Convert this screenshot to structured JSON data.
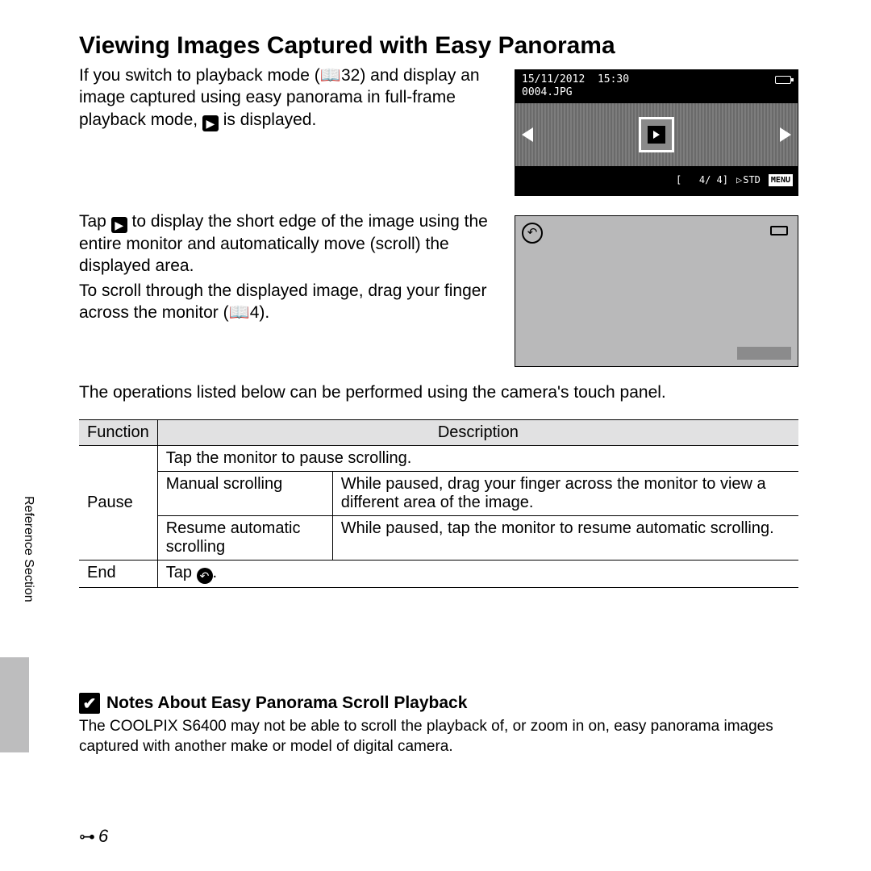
{
  "title": "Viewing Images Captured with Easy Panorama",
  "para1a": "If you switch to playback mode (",
  "para1b": "32) and display an image captured using easy panorama in full-frame playback mode, ",
  "para1c": " is displayed.",
  "para2a": "Tap ",
  "para2b": " to display the short edge of the image using the entire monitor and automatically move (scroll) the displayed area.",
  "para3a": "To scroll through the displayed image, drag your finger across the monitor (",
  "para3b": "4).",
  "para4": "The operations listed below can be performed using the camera's touch panel.",
  "lcd1": {
    "date": "15/11/2012",
    "time": "15:30",
    "file": "0004.JPG",
    "counter": "4/   4",
    "std": "STD",
    "menu": "MENU"
  },
  "table": {
    "h_func": "Function",
    "h_desc": "Description",
    "pause": "Pause",
    "pause_desc": "Tap the monitor to pause scrolling.",
    "manual": "Manual scrolling",
    "manual_desc": "While paused, drag your finger across the monitor to view a different area of the image.",
    "resume": "Resume automatic scrolling",
    "resume_desc": "While paused, tap the monitor to resume automatic scrolling.",
    "end": "End",
    "end_desc_a": "Tap ",
    "end_desc_b": "."
  },
  "side_label": "Reference Section",
  "notes": {
    "heading": "Notes About Easy Panorama Scroll Playback",
    "body": "The COOLPIX S6400 may not be able to scroll the playback of, or zoom in on, easy panorama images captured with another make or model of digital camera."
  },
  "page_number": "6"
}
